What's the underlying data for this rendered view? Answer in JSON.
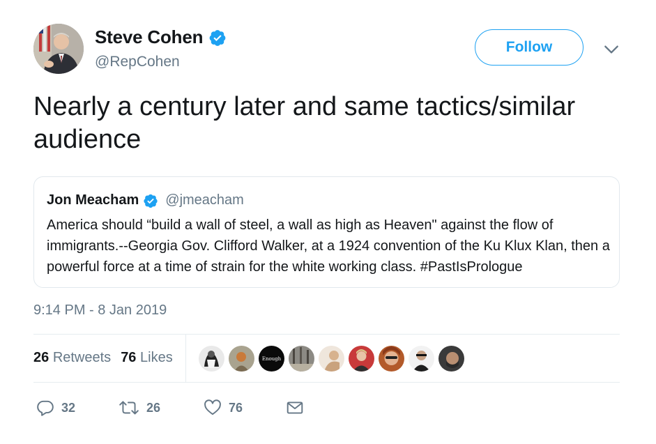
{
  "author": {
    "display_name": "Steve Cohen",
    "handle": "@RepCohen",
    "verified": true,
    "avatar_icon": "profile-photo"
  },
  "follow_label": "Follow",
  "tweet_text": "Nearly a century later and same tactics/similar audience",
  "quoted_tweet": {
    "display_name": "Jon Meacham",
    "handle": "@jmeacham",
    "verified": true,
    "text": "America should “build a wall of steel, a wall as high as Heaven\" against the flow of immigrants.--Georgia Gov. Clifford Walker, at a 1924 convention of the Ku Klux Klan, then a powerful force at a time of strain for the white working class. #PastIsPrologue"
  },
  "timestamp": "9:14 PM - 8 Jan 2019",
  "stats": {
    "retweets_count": "26",
    "retweets_label": "Retweets",
    "likes_count": "76",
    "likes_label": "Likes"
  },
  "liker_avatars": [
    {
      "name": "liker-avatar-1",
      "label": ""
    },
    {
      "name": "liker-avatar-2",
      "label": ""
    },
    {
      "name": "liker-avatar-3",
      "label": "Enough"
    },
    {
      "name": "liker-avatar-4",
      "label": ""
    },
    {
      "name": "liker-avatar-5",
      "label": ""
    },
    {
      "name": "liker-avatar-6",
      "label": ""
    },
    {
      "name": "liker-avatar-7",
      "label": ""
    },
    {
      "name": "liker-avatar-8",
      "label": ""
    },
    {
      "name": "liker-avatar-9",
      "label": ""
    }
  ],
  "actions": {
    "reply_count": "32",
    "retweet_count": "26",
    "like_count": "76"
  },
  "colors": {
    "accent": "#1da1f2",
    "text": "#14171a",
    "secondary": "#657786",
    "border": "#e1e8ed"
  }
}
